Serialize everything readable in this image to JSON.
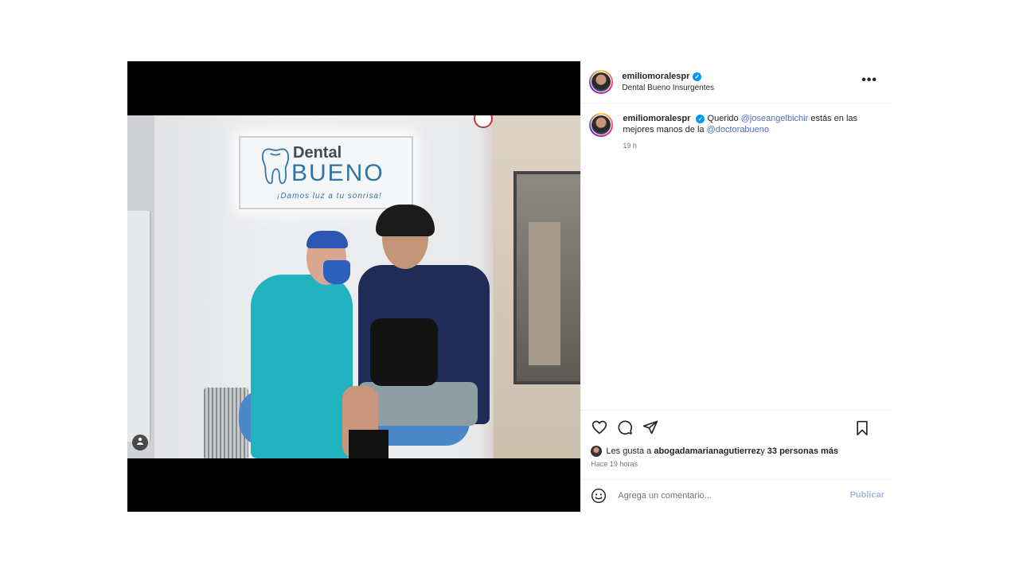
{
  "post": {
    "username": "emiliomoralespr",
    "location": "Dental Bueno Insurgentes",
    "more_glyph": "•••",
    "verified_glyph": "✓"
  },
  "photo_sign": {
    "brand_top": "Dental",
    "brand_main": "BUENO",
    "tagline": "¡Damos luz a tu sonrisa!"
  },
  "caption": {
    "username": "emiliomoralespr",
    "text_before": "Querido ",
    "mention1": "@joseangelbichir",
    "text_middle": " estás en las mejores manos de la ",
    "mention2": "@doctorabueno",
    "time": "19 h"
  },
  "icons": {
    "like": "heart-icon",
    "comment": "comment-icon",
    "share": "share-icon",
    "save": "bookmark-icon",
    "emoji": "emoji-icon",
    "user_tag": "user-tag-icon"
  },
  "likes": {
    "prefix": "Les gusta a ",
    "user": "abogadamarianagutierrez",
    "middle": " y ",
    "others": "33 personas más"
  },
  "posted_ago": "Hace 19 horas",
  "comment_box": {
    "placeholder": "Agrega un comentario...",
    "publish_label": "Publicar"
  },
  "colors": {
    "link": "#385185",
    "verified": "#0095f6",
    "publish_disabled": "#a0b8e0"
  }
}
